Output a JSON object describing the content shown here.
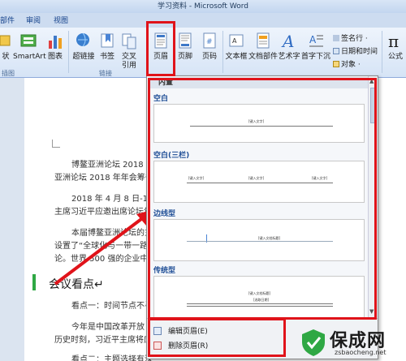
{
  "window": {
    "title": "学习资料 - Microsoft Word"
  },
  "tabs": [
    "部件",
    "审阅",
    "视图"
  ],
  "ribbon": {
    "buttons": [
      {
        "label": "状",
        "icon": "shape-icon"
      },
      {
        "label": "SmartArt",
        "icon": "smartart-icon"
      },
      {
        "label": "图表",
        "icon": "chart-icon"
      },
      {
        "label": "超链接",
        "icon": "hyperlink-icon"
      },
      {
        "label": "书签",
        "icon": "bookmark-icon"
      },
      {
        "label": "交叉\n引用",
        "icon": "cross-reference-icon"
      },
      {
        "label": "页眉",
        "icon": "header-icon"
      },
      {
        "label": "页脚",
        "icon": "footer-icon"
      },
      {
        "label": "页码",
        "icon": "page-number-icon"
      },
      {
        "label": "文本框",
        "icon": "textbox-icon"
      },
      {
        "label": "文档部件",
        "icon": "quick-parts-icon"
      },
      {
        "label": "艺术字",
        "icon": "wordart-icon"
      },
      {
        "label": "首字下沉",
        "icon": "drop-cap-icon"
      },
      {
        "label": "公式",
        "icon": "equation-icon"
      }
    ],
    "small": [
      {
        "label": "签名行 ·",
        "icon": "signature-icon"
      },
      {
        "label": "日期和时间",
        "icon": "datetime-icon"
      },
      {
        "label": "对象 ·",
        "icon": "object-icon"
      }
    ],
    "groups": [
      "插图",
      "链接"
    ]
  },
  "gallery": {
    "title": "内置",
    "sections": [
      {
        "label": "空白",
        "placeholder": "[键入文字]"
      },
      {
        "label": "空白(三栏)",
        "placeholders": [
          "[键入文字]",
          "[键入文字]",
          "[键入文字]"
        ]
      },
      {
        "label": "边线型",
        "placeholder": "[键入文档标题]"
      },
      {
        "label": "传统型",
        "placeholders": [
          "[键入文档标题]",
          "[选取日期]"
        ]
      }
    ],
    "menu": [
      "编辑页眉(E)",
      "删除页眉(R)"
    ]
  },
  "document": {
    "lines": [
      "博鳌亚洲论坛 2018 年",
      "亚洲论坛 2018 年年会筹备",
      "2018 年 4 月 8 日-11",
      "主席习近平应邀出席论坛年",
      "本届博鳌亚洲论坛的主",
      "设置了“全球化与一带一路”",
      "论。世界 500 强的企业中有",
      "会议看点↵",
      "看点一：时间节点不寻",
      "今年是中国改革开放 4",
      "历史时刻，习近平主席将应",
      "看点二：主题选择有深"
    ]
  },
  "watermark": {
    "title": "保成网",
    "url": "zsbaocheng.net"
  },
  "colors": {
    "highlight": "#e0131a",
    "accent": "#1f4e96",
    "logo_green": "#2fa844"
  }
}
